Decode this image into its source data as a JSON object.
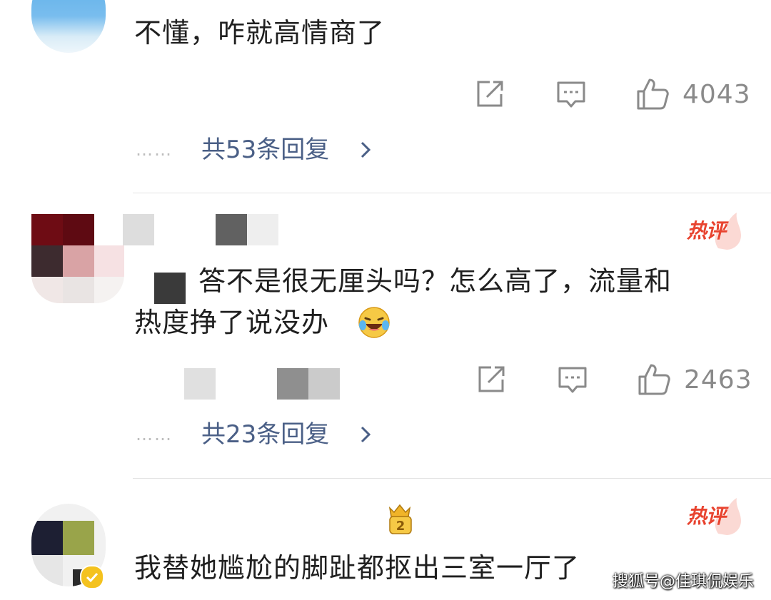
{
  "comments": [
    {
      "text": "不懂，咋就高情商了",
      "like_count": "4043",
      "replies_label": "共53条回复",
      "replies_dots": "……"
    },
    {
      "badge": "热评",
      "text_line1": "答不是很无厘头吗？怎么高了，流量和",
      "text_line2": "热度挣了说没办",
      "like_count": "2463",
      "replies_label": "共23条回复",
      "replies_dots": "……"
    },
    {
      "badge": "热评",
      "text": "我替她尴尬的脚趾都抠出三室一厅了"
    }
  ],
  "icons": {
    "share": "share-icon",
    "comment": "comment-icon",
    "like": "thumbs-up-icon",
    "chevron": "chevron-right-icon",
    "emoji": "laughing-crying-emoji-icon",
    "vip": "vip-crown-icon"
  },
  "colors": {
    "text": "#1f1f1f",
    "link": "#4a5f86",
    "muted": "#8a8a8a",
    "hot": "#e8432f"
  },
  "watermark": "搜狐号@佳琪侃娱乐"
}
